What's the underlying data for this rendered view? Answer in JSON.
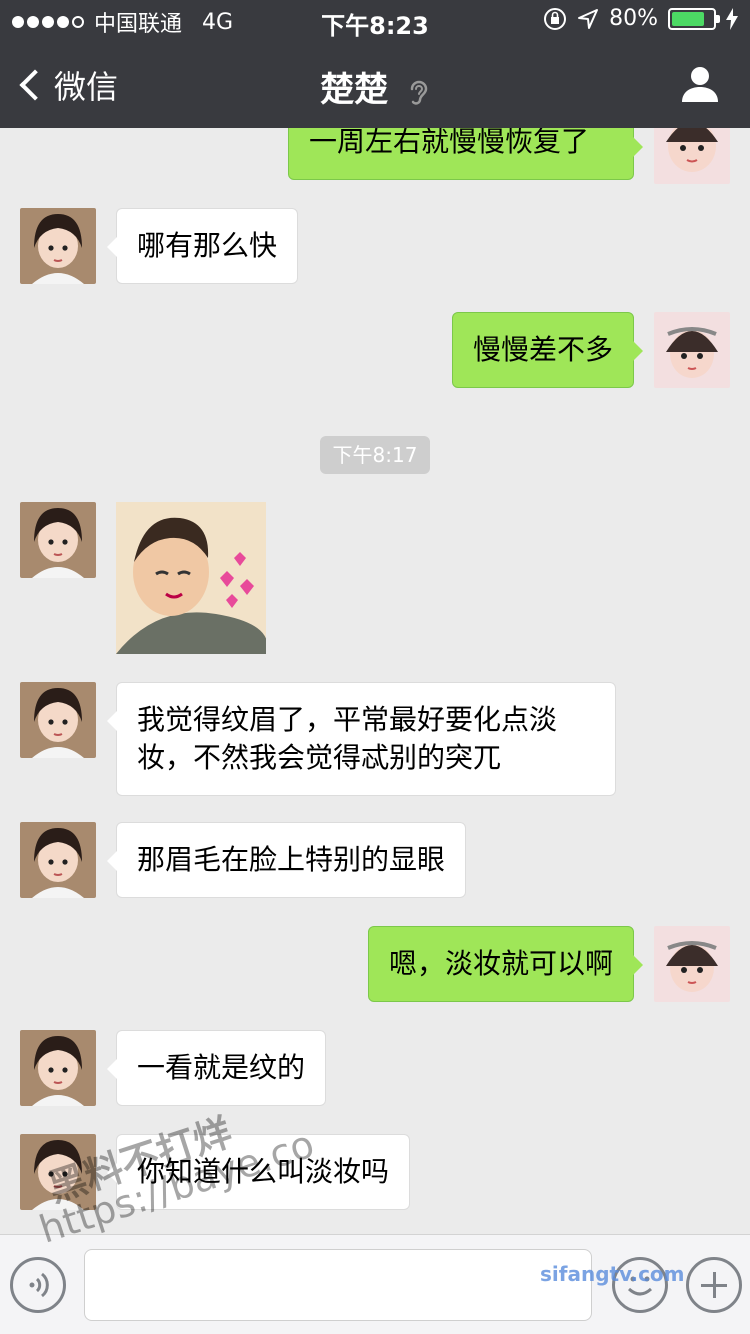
{
  "status_bar": {
    "carrier": "中国联通",
    "network": "4G",
    "time": "下午8:23",
    "battery_percent": "80%",
    "battery_level": 0.8,
    "icons": [
      "signal-dots-icon",
      "lock-rotation-icon",
      "location-arrow-icon",
      "battery-icon",
      "charging-bolt-icon"
    ]
  },
  "nav": {
    "back_label": "微信",
    "title": "楚楚",
    "title_icon": "ear-icon",
    "right_icon": "user-profile-icon"
  },
  "messages": [
    {
      "side": "me",
      "text": "一周左右就慢慢恢复了"
    },
    {
      "side": "other",
      "text": "哪有那么快"
    },
    {
      "side": "me",
      "text": "慢慢差不多"
    },
    {
      "type": "timestamp",
      "text": "下午8:17"
    },
    {
      "side": "other",
      "type": "sticker",
      "text": ""
    },
    {
      "side": "other",
      "text": "我觉得纹眉了，平常最好要化点淡妆，不然我会觉得忒别的突兀"
    },
    {
      "side": "other",
      "text": "那眉毛在脸上特别的显眼"
    },
    {
      "side": "me",
      "text": "嗯，淡妆就可以啊"
    },
    {
      "side": "other",
      "text": "一看就是纹的"
    },
    {
      "side": "other",
      "text": "你知道什么叫淡妆吗"
    }
  ],
  "input_bar": {
    "placeholder": "",
    "icons": [
      "voice-icon",
      "emoji-icon",
      "plus-icon"
    ]
  },
  "watermarks": [
    "黑料不打烊",
    "https://baye.co",
    "sifangtv.com"
  ],
  "colors": {
    "nav_bg": "#393a3f",
    "chat_bg": "#ebebeb",
    "me_bubble": "#9fe658",
    "other_bubble": "#ffffff",
    "battery_fill": "#4cd964"
  }
}
